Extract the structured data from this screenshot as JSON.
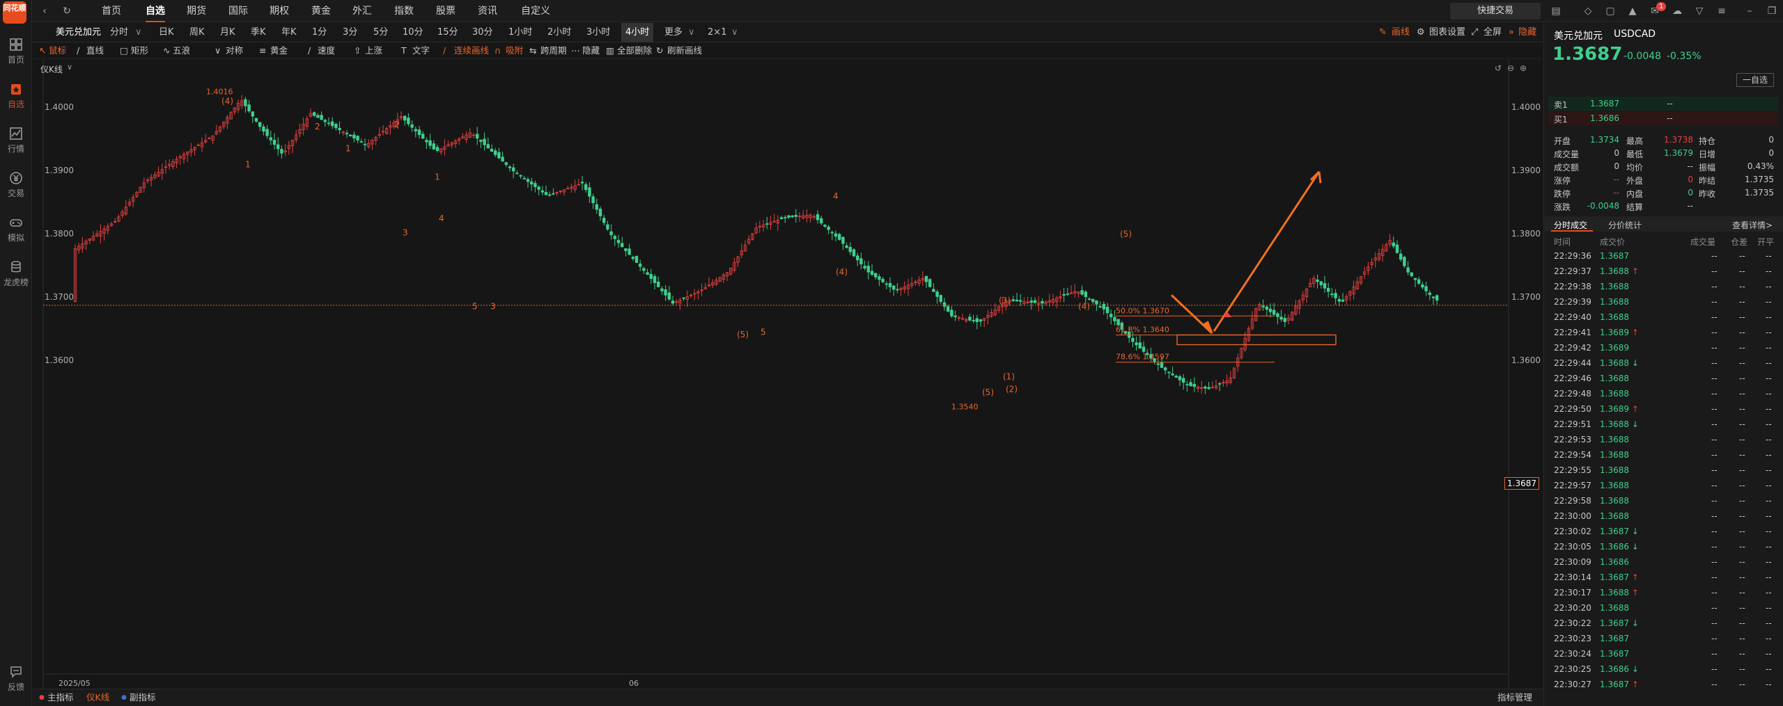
{
  "app": {
    "logo_text": "同花顺"
  },
  "rail": [
    {
      "label": "首页",
      "icon": "grid-icon"
    },
    {
      "label": "自选",
      "icon": "star-folder-icon",
      "active": true
    },
    {
      "label": "行情",
      "icon": "trend-icon"
    },
    {
      "label": "交易",
      "icon": "yen-icon"
    },
    {
      "label": "模拟",
      "icon": "gamepad-icon"
    },
    {
      "label": "龙虎榜",
      "icon": "database-icon"
    },
    {
      "label": "反馈",
      "icon": "feedback-icon"
    }
  ],
  "nav": [
    {
      "label": "首页"
    },
    {
      "label": "自选",
      "active": true
    },
    {
      "label": "期货"
    },
    {
      "label": "国际"
    },
    {
      "label": "期权"
    },
    {
      "label": "黄金"
    },
    {
      "label": "外汇"
    },
    {
      "label": "指数"
    },
    {
      "label": "股票"
    },
    {
      "label": "资讯"
    },
    {
      "label": "自定义"
    }
  ],
  "topbar": {
    "quick_trade": "快捷交易",
    "badge_count": "1"
  },
  "periodbar": {
    "symbol": "美元兑加元",
    "periods": [
      "分时",
      "日K",
      "周K",
      "月K",
      "季K",
      "年K",
      "1分",
      "3分",
      "5分",
      "10分",
      "15分",
      "30分",
      "1小时",
      "2小时",
      "3小时",
      "4小时",
      "更多",
      "2×1"
    ],
    "active_period": "4小时",
    "draw_line": "画线",
    "chart_settings": "图表设置",
    "fullscreen": "全屏",
    "hide": "隐藏"
  },
  "drawbar": {
    "items": [
      "鼠标",
      "直线",
      "矩形",
      "五浪",
      "对称",
      "黄金",
      "速度",
      "上涨",
      "文字",
      "连续画线",
      "吸附",
      "跨周期",
      "隐藏",
      "全部删除",
      "刷新画线"
    ]
  },
  "chart": {
    "indicator_label": "仪K线",
    "current_price_label": "1.3687",
    "x_labels": [
      "2025/05",
      "06"
    ]
  },
  "chart_data": {
    "type": "candlestick",
    "title": "美元兑加元 USDCAD",
    "y_ticks": [
      1.36,
      1.37,
      1.38,
      1.39,
      1.4
    ],
    "ylim": [
      1.352,
      1.4095
    ],
    "current_price": 1.3687,
    "high_label": "1.4016",
    "low_label": "1.3540",
    "fib_levels": [
      {
        "label": "50.0% 1.3670",
        "value": 1.367
      },
      {
        "label": "61.8% 1.3640",
        "value": 1.364
      },
      {
        "label": "78.6% 1.3597",
        "value": 1.3597
      }
    ],
    "wave_labels": [
      "(4)",
      "1",
      "2",
      "1",
      "2",
      "1",
      "4",
      "3",
      "5",
      "3",
      "4",
      "(4)",
      "(5)",
      "5",
      "(3)",
      "(4)",
      "(1)",
      "(2)",
      "(5)",
      "(5)"
    ]
  },
  "bottombar": {
    "main": "主指标",
    "kline": "仪K线",
    "sub": "副指标",
    "manage": "指标管理"
  },
  "quote": {
    "name": "美元兑加元",
    "code": "USDCAD",
    "price": "1.3687",
    "change": "-0.0048",
    "change_pct": "-0.35%",
    "watch_btn": "一自选",
    "sell_label": "卖1",
    "sell_price": "1.3687",
    "sell_vol": "--",
    "buy_label": "买1",
    "buy_price": "1.3686",
    "buy_vol": "--"
  },
  "stats": [
    [
      "开盘",
      "1.3734",
      "最高",
      "1.3738",
      "持仓",
      "0"
    ],
    [
      "成交量",
      "0",
      "最低",
      "1.3679",
      "日增",
      "0"
    ],
    [
      "成交额",
      "0",
      "均价",
      "--",
      "振幅",
      "0.43%"
    ],
    [
      "涨停",
      "--",
      "外盘",
      "0",
      "昨结",
      "1.3735"
    ],
    [
      "跌停",
      "--",
      "内盘",
      "0",
      "昨收",
      "1.3735"
    ],
    [
      "涨跌",
      "-0.0048",
      "结算",
      "--",
      "",
      ""
    ]
  ],
  "ticks_header": {
    "tab1": "分时成交",
    "tab2": "分价统计",
    "more": "查看详情>",
    "col_time": "时间",
    "col_price": "成交价",
    "col_vol": "成交量",
    "col_oi": "仓差",
    "col_open": "开平"
  },
  "ticks": [
    [
      "22:29:36",
      "1.3687",
      ""
    ],
    [
      "22:29:37",
      "1.3688",
      "up"
    ],
    [
      "22:29:38",
      "1.3688",
      ""
    ],
    [
      "22:29:39",
      "1.3688",
      ""
    ],
    [
      "22:29:40",
      "1.3688",
      ""
    ],
    [
      "22:29:41",
      "1.3689",
      "up"
    ],
    [
      "22:29:42",
      "1.3689",
      ""
    ],
    [
      "22:29:44",
      "1.3688",
      "down"
    ],
    [
      "22:29:46",
      "1.3688",
      ""
    ],
    [
      "22:29:48",
      "1.3688",
      ""
    ],
    [
      "22:29:50",
      "1.3689",
      "up"
    ],
    [
      "22:29:51",
      "1.3688",
      "down"
    ],
    [
      "22:29:53",
      "1.3688",
      ""
    ],
    [
      "22:29:54",
      "1.3688",
      ""
    ],
    [
      "22:29:55",
      "1.3688",
      ""
    ],
    [
      "22:29:57",
      "1.3688",
      ""
    ],
    [
      "22:29:58",
      "1.3688",
      ""
    ],
    [
      "22:30:00",
      "1.3688",
      ""
    ],
    [
      "22:30:02",
      "1.3687",
      "down"
    ],
    [
      "22:30:05",
      "1.3686",
      "down"
    ],
    [
      "22:30:09",
      "1.3686",
      ""
    ],
    [
      "22:30:14",
      "1.3687",
      "up"
    ],
    [
      "22:30:17",
      "1.3688",
      "up"
    ],
    [
      "22:30:20",
      "1.3688",
      ""
    ],
    [
      "22:30:22",
      "1.3687",
      "down"
    ],
    [
      "22:30:23",
      "1.3687",
      ""
    ],
    [
      "22:30:24",
      "1.3687",
      ""
    ],
    [
      "22:30:25",
      "1.3686",
      "down"
    ],
    [
      "22:30:27",
      "1.3687",
      "up"
    ]
  ]
}
